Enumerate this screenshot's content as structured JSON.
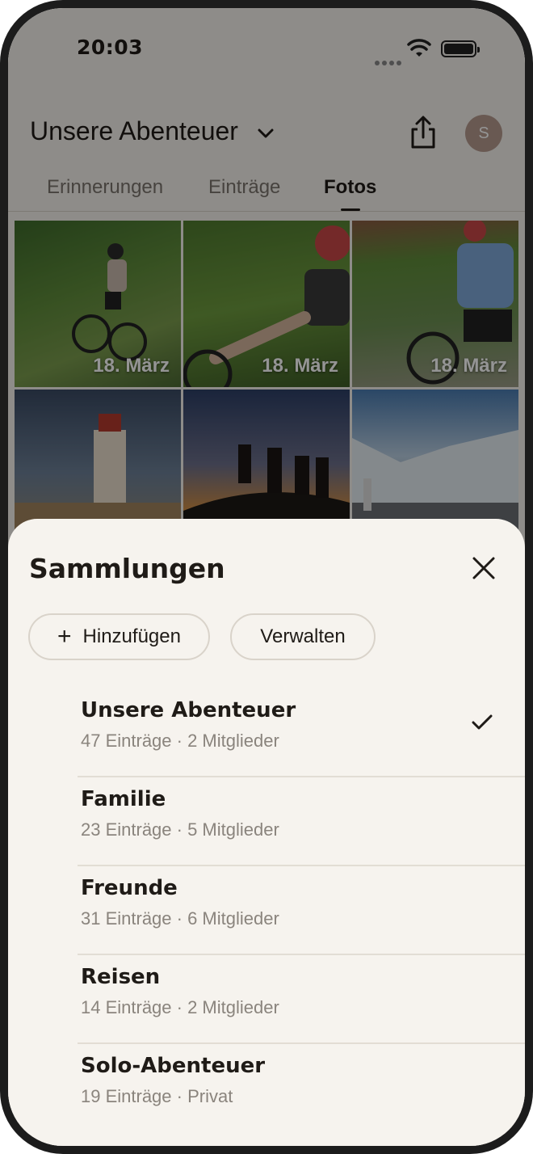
{
  "status": {
    "time": "20:03"
  },
  "header": {
    "collection": "Unsere Abenteuer",
    "avatar_initial": "S"
  },
  "tabs": [
    {
      "label": "Erinnerungen"
    },
    {
      "label": "Einträge"
    },
    {
      "label": "Fotos"
    }
  ],
  "photos": [
    {
      "label": "18. März"
    },
    {
      "label": "18. März"
    },
    {
      "label": "18. März"
    },
    {
      "label": ""
    },
    {
      "label": ""
    },
    {
      "label": ""
    }
  ],
  "sheet": {
    "title": "Sammlungen",
    "add_label": "Hinzufügen",
    "add_icon": "+",
    "manage_label": "Verwalten",
    "items": [
      {
        "name": "Unsere Abenteuer",
        "meta": "47 Einträge · 2 Mitglieder",
        "selected": true
      },
      {
        "name": "Familie",
        "meta": "23 Einträge · 5 Mitglieder",
        "selected": false
      },
      {
        "name": "Freunde",
        "meta": "31 Einträge · 6 Mitglieder",
        "selected": false
      },
      {
        "name": "Reisen",
        "meta": "14 Einträge · 2 Mitglieder",
        "selected": false
      },
      {
        "name": "Solo-Abenteuer",
        "meta": "19 Einträge · Privat",
        "selected": false
      }
    ]
  },
  "icons": {
    "chevron": "chevron-down-icon",
    "share": "share-icon",
    "close": "close-icon",
    "check": "checkmark-icon",
    "wifi": "wifi-icon",
    "battery": "battery-icon"
  }
}
